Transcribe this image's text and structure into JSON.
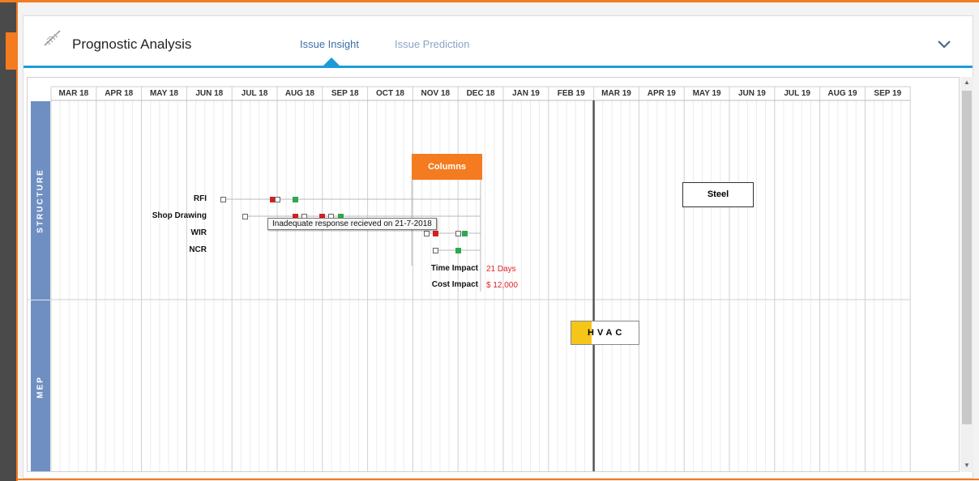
{
  "header": {
    "title": "Prognostic Analysis",
    "tabs": [
      {
        "label": "Issue Insight",
        "active": true
      },
      {
        "label": "Issue Prediction",
        "active": false
      }
    ]
  },
  "timeline": {
    "months": [
      "MAR 18",
      "APR 18",
      "MAY 18",
      "JUN 18",
      "JUL 18",
      "AUG 18",
      "SEP 18",
      "OCT 18",
      "NOV 18",
      "DEC 18",
      "JAN 19",
      "FEB 19",
      "MAR 19",
      "APR 19",
      "MAY 19",
      "JUN 19",
      "JUL 19",
      "AUG 19",
      "SEP 19"
    ],
    "today_marker": "MAR 19"
  },
  "bands": [
    {
      "label": "STRUCTURE"
    },
    {
      "label": "MEP"
    }
  ],
  "activities": {
    "columns": "Columns",
    "steel": "Steel",
    "hvac": "HVAC"
  },
  "issue_rows": [
    {
      "label": "RFI",
      "markers": [
        {
          "month": 3.8,
          "status": "empty"
        },
        {
          "month": 4.9,
          "status": "red"
        },
        {
          "month": 5.0,
          "status": "empty"
        },
        {
          "month": 5.4,
          "status": "green"
        }
      ]
    },
    {
      "label": "Shop Drawing",
      "markers": [
        {
          "month": 4.3,
          "status": "empty"
        },
        {
          "month": 5.4,
          "status": "red"
        },
        {
          "month": 5.6,
          "status": "empty"
        },
        {
          "month": 6.0,
          "status": "red"
        },
        {
          "month": 6.2,
          "status": "empty"
        },
        {
          "month": 6.4,
          "status": "green"
        }
      ]
    },
    {
      "label": "WIR",
      "markers": [
        {
          "month": 8.3,
          "status": "empty"
        },
        {
          "month": 8.5,
          "status": "red"
        },
        {
          "month": 9.0,
          "status": "empty"
        },
        {
          "month": 9.15,
          "status": "green"
        }
      ]
    },
    {
      "label": "NCR",
      "markers": [
        {
          "month": 8.5,
          "status": "empty"
        },
        {
          "month": 9.0,
          "status": "green"
        }
      ]
    }
  ],
  "tooltip": "Inadequate response recieved on 21-7-2018",
  "impact": {
    "time_label": "Time Impact",
    "time_value": "21 Days",
    "cost_label": "Cost Impact",
    "cost_value": "$ 12,000"
  },
  "colors": {
    "accent": "#f47b20",
    "tab_active": "#3b6ea8",
    "band": "#6f8fc2",
    "issue_open": "#d12020",
    "issue_closed": "#2ea84a",
    "hvac_accent": "#f5c518",
    "impact_value": "#e02424"
  }
}
